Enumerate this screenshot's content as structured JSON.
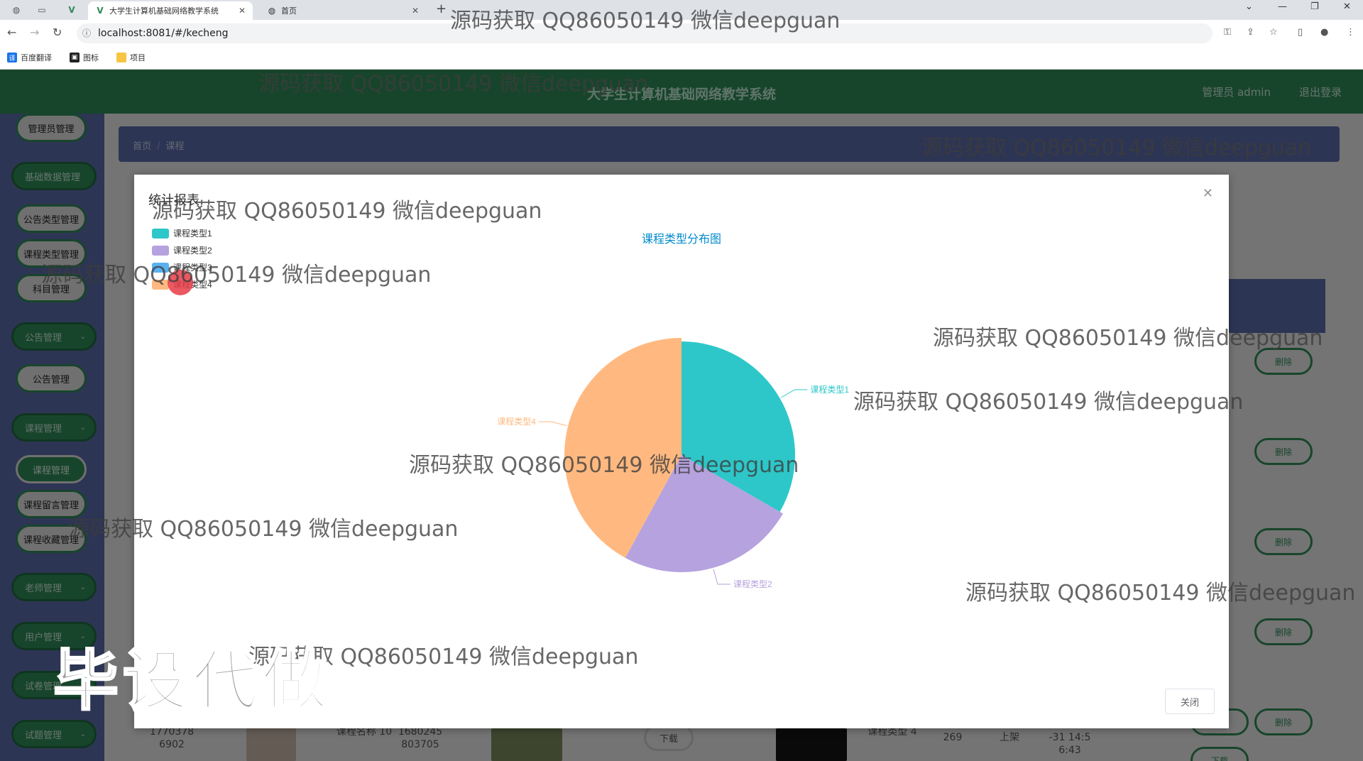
{
  "browser": {
    "tabs": [
      {
        "title": "大学生计算机基础网络教学系统",
        "active": true
      },
      {
        "title": "首页",
        "active": false
      }
    ],
    "url": "localhost:8081/#/kecheng",
    "bookmarks": [
      "百度翻译",
      "图标",
      "项目"
    ]
  },
  "app": {
    "title": "大学生计算机基础网络教学系统",
    "user": "管理员 admin",
    "logout": "退出登录"
  },
  "sidebar": {
    "items": [
      {
        "label": "管理员管理",
        "type": "item"
      },
      {
        "label": "基础数据管理",
        "type": "group"
      },
      {
        "label": "公告类型管理",
        "type": "item"
      },
      {
        "label": "课程类型管理",
        "type": "item"
      },
      {
        "label": "科目管理",
        "type": "item"
      },
      {
        "label": "公告管理",
        "type": "group"
      },
      {
        "label": "公告管理",
        "type": "item"
      },
      {
        "label": "课程管理",
        "type": "group"
      },
      {
        "label": "课程管理",
        "type": "selected"
      },
      {
        "label": "课程留言管理",
        "type": "item"
      },
      {
        "label": "课程收藏管理",
        "type": "item"
      },
      {
        "label": "老师管理",
        "type": "group"
      },
      {
        "label": "用户管理",
        "type": "group"
      },
      {
        "label": "试卷管理",
        "type": "group"
      },
      {
        "label": "试题管理",
        "type": "group"
      }
    ]
  },
  "breadcrumb": {
    "home": "首页",
    "current": "课程"
  },
  "table": {
    "delete_label": "删除",
    "download_label": "下载",
    "bottom_row": {
      "c1": "1770378 6902",
      "c2": "课程名称 10",
      "c3": "1680245 803705",
      "c4": "下载",
      "c5": "课程类型 4",
      "c6": "269",
      "c7": "上架",
      "c8": "-31 14:5 6:43"
    }
  },
  "modal": {
    "title": "统计报表",
    "close_label": "关闭"
  },
  "chart_data": {
    "type": "pie",
    "title": "课程类型分布图",
    "legend_position": "top-left",
    "series": [
      {
        "name": "课程类型1",
        "value": 23,
        "color": "#2ec7c9"
      },
      {
        "name": "课程类型2",
        "value": 17,
        "color": "#b6a2de"
      },
      {
        "name": "课程类型3",
        "value": 0,
        "color": "#5ab1ef"
      },
      {
        "name": "课程类型4",
        "value": 29,
        "color": "#ffb980"
      }
    ]
  },
  "watermarks": {
    "text": "源码获取 QQ86050149 微信deepguan",
    "big": "毕设代做"
  }
}
